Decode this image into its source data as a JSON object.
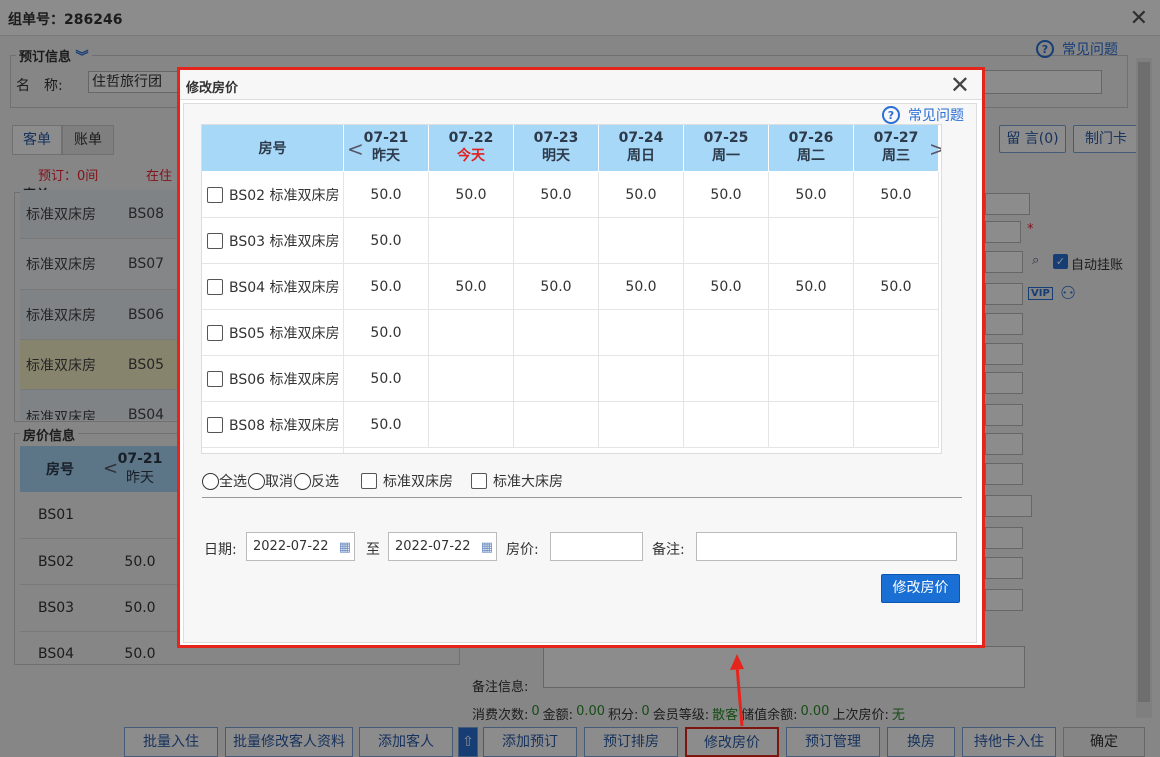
{
  "background": {
    "title": "组单号：286246",
    "booking_legend": "预订信息",
    "name_label": "名　称:",
    "name_value": "住哲旅行团",
    "help_text": "常见问题",
    "tabs": [
      "客单",
      "账单"
    ],
    "reserve_text": "预订：0间",
    "in_text": "在住",
    "guest_legend": "客单",
    "guest_rows": [
      {
        "type": "标准双床房",
        "room": "BS08"
      },
      {
        "type": "标准双床房",
        "room": "BS07"
      },
      {
        "type": "标准双床房",
        "room": "BS06"
      },
      {
        "type": "标准双床房",
        "room": "BS05"
      },
      {
        "type": "标准双床房",
        "room": "BS04"
      }
    ],
    "price_legend": "房价信息",
    "price_header": {
      "room": "房号",
      "date": "07-21",
      "week": "昨天"
    },
    "price_rows": [
      {
        "room": "BS01",
        "price": ""
      },
      {
        "room": "BS02",
        "price": "50.0"
      },
      {
        "room": "BS03",
        "price": "50.0"
      },
      {
        "room": "BS04",
        "price": "50.0"
      }
    ],
    "right_buttons": [
      "留 言(0)",
      "制门卡"
    ],
    "auto_checkout": "自动挂账",
    "vip_label": "VIP",
    "remark_label": "备注信息:",
    "stats": {
      "count_label": "消费次数:",
      "count": "0",
      "amount_label": "金额:",
      "amount": "0.00",
      "points_label": "积分:",
      "points": "0",
      "level_label": "会员等级:",
      "level": "散客",
      "balance_label": "储值余额:",
      "balance": "0.00",
      "last_label": "上次房价:",
      "last": "无"
    },
    "bottom_buttons": [
      "批量入住",
      "批量修改客人资料",
      "添加客人",
      "添加预订",
      "预订排房",
      "修改房价",
      "预订管理",
      "换房",
      "持他卡入住",
      "确定"
    ]
  },
  "modal": {
    "title": "修改房价",
    "help_text": "常见问题",
    "grid_header_room": "房号",
    "dates": [
      {
        "date": "07-21",
        "week": "昨天"
      },
      {
        "date": "07-22",
        "week": "今天"
      },
      {
        "date": "07-23",
        "week": "明天"
      },
      {
        "date": "07-24",
        "week": "周日"
      },
      {
        "date": "07-25",
        "week": "周一"
      },
      {
        "date": "07-26",
        "week": "周二"
      },
      {
        "date": "07-27",
        "week": "周三"
      }
    ],
    "rows": [
      {
        "label": "BS02 标准双床房",
        "prices": [
          "50.0",
          "50.0",
          "50.0",
          "50.0",
          "50.0",
          "50.0",
          "50.0"
        ]
      },
      {
        "label": "BS03 标准双床房",
        "prices": [
          "50.0",
          "",
          "",
          "",
          "",
          "",
          ""
        ]
      },
      {
        "label": "BS04 标准双床房",
        "prices": [
          "50.0",
          "50.0",
          "50.0",
          "50.0",
          "50.0",
          "50.0",
          "50.0"
        ]
      },
      {
        "label": "BS05 标准双床房",
        "prices": [
          "50.0",
          "",
          "",
          "",
          "",
          "",
          ""
        ]
      },
      {
        "label": "BS06 标准双床房",
        "prices": [
          "50.0",
          "",
          "",
          "",
          "",
          "",
          ""
        ]
      },
      {
        "label": "BS08 标准双床房",
        "prices": [
          "50.0",
          "",
          "",
          "",
          "",
          "",
          ""
        ]
      }
    ],
    "select_all": "全选",
    "cancel": "取消",
    "invert": "反选",
    "filter_double": "标准双床房",
    "filter_king": "标准大床房",
    "date_label": "日期:",
    "date_from": "2022-07-22",
    "to_label": "至",
    "date_to": "2022-07-22",
    "price_label": "房价:",
    "price_value": "",
    "remark_label": "备注:",
    "remark_value": "",
    "submit_label": "修改房价"
  },
  "colors": {
    "accent": "#e5251c",
    "header": "#a8d8f8",
    "button": "#1a6fd4",
    "today": "#e02020"
  }
}
